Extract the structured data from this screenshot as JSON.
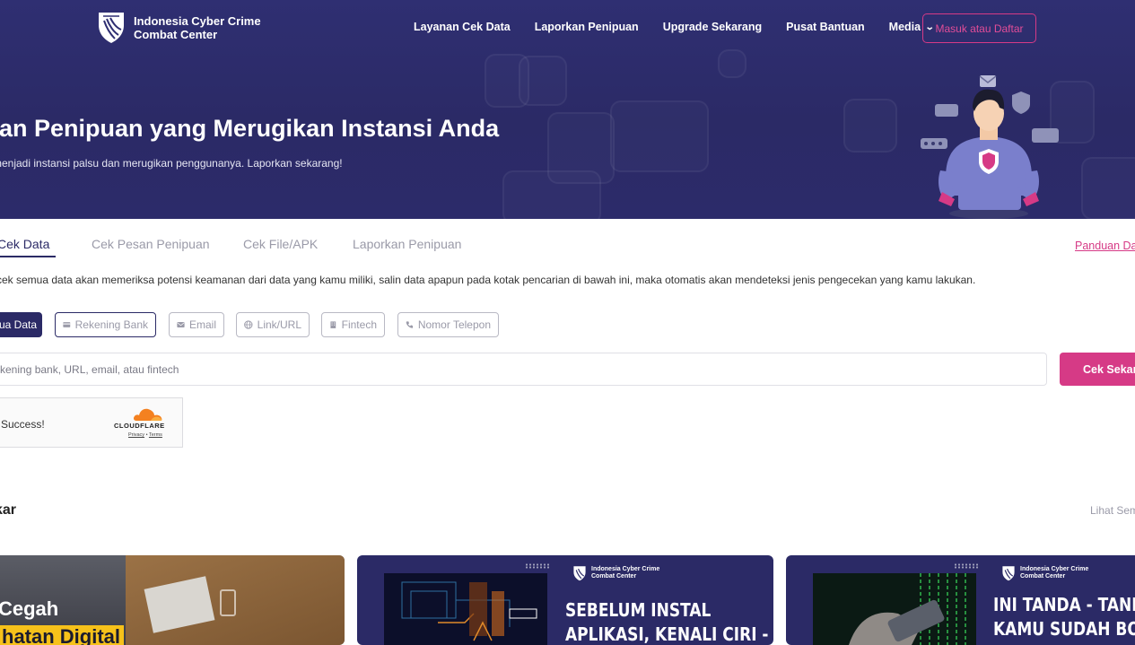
{
  "brand": {
    "name_line1": "Indonesia Cyber Crime",
    "name_line2": "Combat Center"
  },
  "nav": {
    "items": [
      "Layanan Cek Data",
      "Laporkan Penipuan",
      "Upgrade Sekarang",
      "Pusat Bantuan"
    ],
    "media_label": "Media",
    "login_label": "Masuk atau Daftar"
  },
  "hero": {
    "title": "kan Penipuan yang Merugikan Instansi Anda",
    "subtitle": "menjadi instansi palsu dan merugikan penggunanya. Laporkan sekarang!"
  },
  "tabs": {
    "items": [
      "Cek Data",
      "Cek Pesan Penipuan",
      "Cek File/APK",
      "Laporkan Penipuan"
    ],
    "guide_link": "Panduan Dat"
  },
  "description": "cek semua data akan memeriksa potensi keamanan dari data yang kamu miliki, salin data apapun pada kotak pencarian di bawah ini, maka otomatis akan mendeteksi jenis pengecekan yang kamu lakukan.",
  "filters": {
    "all_label": "ua Data",
    "items": [
      "Rekening Bank",
      "Email",
      "Link/URL",
      "Fintech",
      "Nomor Telepon"
    ]
  },
  "search": {
    "placeholder": "kening bank, URL, email, atau fintech",
    "button_label": "Cek Sekarang"
  },
  "captcha": {
    "status": "Success!",
    "provider": "CLOUDFLARE",
    "privacy": "Privacy",
    "separator": "•",
    "terms": "Terms"
  },
  "section": {
    "title": "kar",
    "see_all": "Lihat Sem"
  },
  "cards": [
    {
      "title": "Cegah",
      "highlight": "hatan Digital"
    },
    {
      "logo_line1": "Indonesia Cyber Crime",
      "logo_line2": "Combat Center",
      "headline_line1": "SEBELUM INSTAL",
      "headline_line2": "APLIKASI, KENALI CIRI -"
    },
    {
      "logo_line1": "Indonesia Cyber Crime",
      "logo_line2": "Combat Center",
      "headline_line1": "INI TANDA - TANDA",
      "headline_line2": "KAMU SUDAH BOCOR"
    }
  ]
}
